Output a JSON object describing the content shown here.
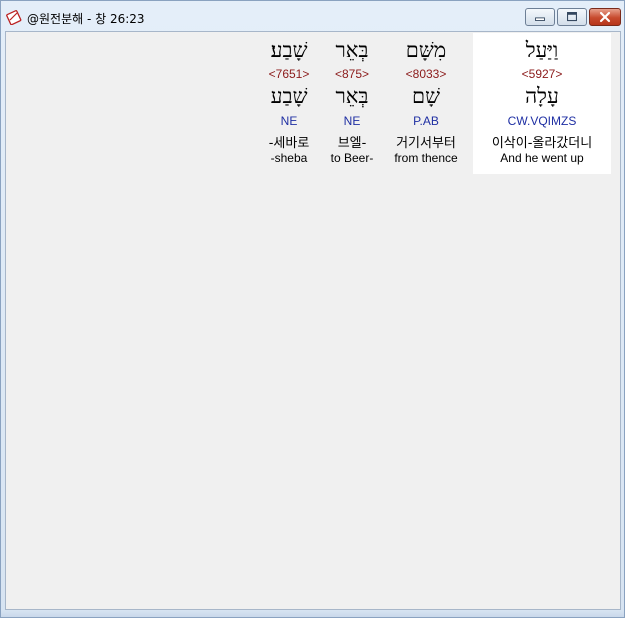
{
  "window": {
    "title": "@원전분해 - 창 26:23"
  },
  "colors": {
    "strong": "#8b1a1a",
    "morph": "#1f2fa3",
    "highlight": "#ffffff",
    "client_bg": "#f0f0f0"
  },
  "words": [
    {
      "hebrew_form": "וַיַּעַל",
      "strong": "<5927>",
      "lemma": "עָלָה",
      "morph": "CW.VQIMZS",
      "korean": "이삭이-올라갔더니",
      "english": "And he went up",
      "highlighted": true
    },
    {
      "hebrew_form": "מִשָּׁם",
      "strong": "<8033>",
      "lemma": "שָׁם",
      "morph": "P.AB",
      "korean": "거기서부터",
      "english": "from thence",
      "highlighted": false
    },
    {
      "hebrew_form": "בְּאֵר",
      "strong": "<875>",
      "lemma": "בְּאֵר",
      "morph": "NE",
      "korean": "브엘-",
      "english": "to Beer-",
      "highlighted": false
    },
    {
      "hebrew_form": "שָׁבַע׃",
      "strong": "<7651>",
      "lemma": "שָׁבַע",
      "morph": "NE",
      "korean": "-세바로",
      "english": "-sheba",
      "highlighted": false
    }
  ]
}
